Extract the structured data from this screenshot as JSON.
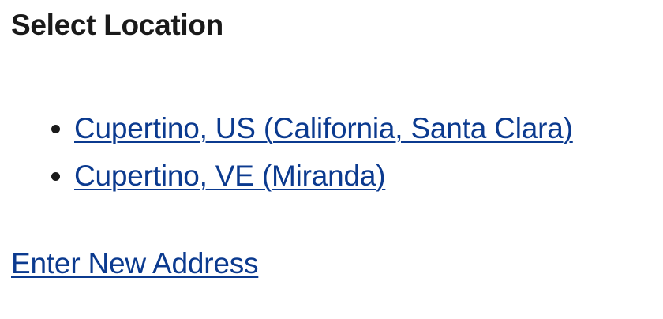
{
  "page": {
    "title": "Select Location"
  },
  "locations": [
    {
      "label": "Cupertino, US (California, Santa Clara)"
    },
    {
      "label": "Cupertino, VE (Miranda)"
    }
  ],
  "actions": {
    "new_address_label": "Enter New Address"
  },
  "colors": {
    "link": "#0b3a8f",
    "text": "#1a1a1a",
    "background": "#ffffff"
  }
}
